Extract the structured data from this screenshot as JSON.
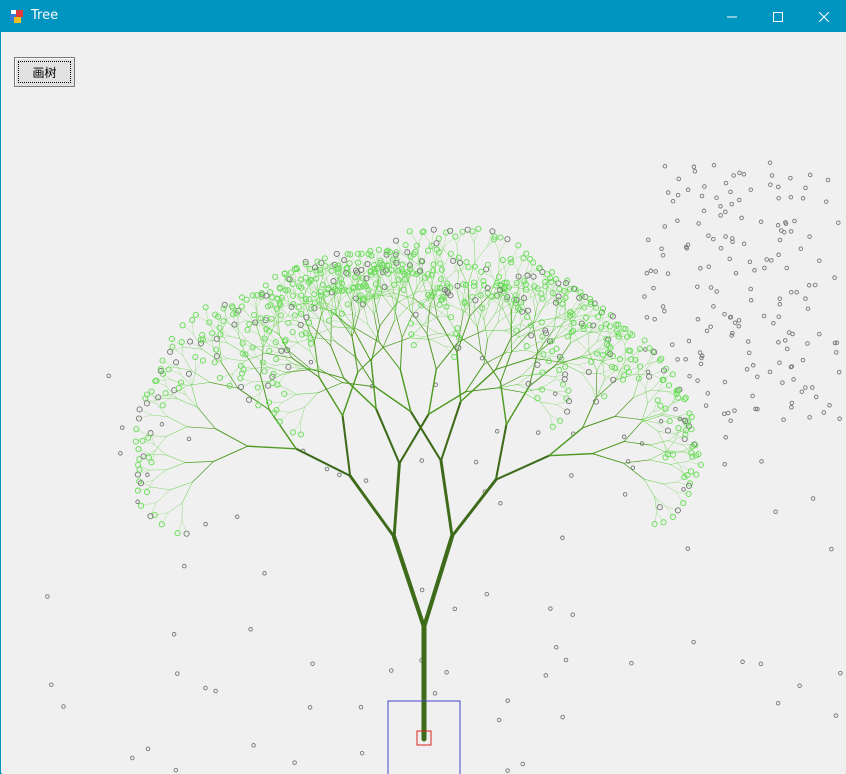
{
  "window": {
    "title": "Tree",
    "controls": {
      "minimize": "minimize",
      "maximize": "maximize",
      "close": "close"
    }
  },
  "toolbar": {
    "draw_button_label": "画树"
  },
  "colors": {
    "titlebar": "#0095c0",
    "client_bg": "#f0f0f0",
    "trunk": "#3d6b1a",
    "branch": "#4e9a22",
    "twig": "#55cc33",
    "leaf_ring_green": "#66dd55",
    "leaf_ring_gray": "#777777",
    "base_box": "#4444cc",
    "root_marker": "#dd2222"
  },
  "icons": {
    "app": "tree-app-icon"
  }
}
